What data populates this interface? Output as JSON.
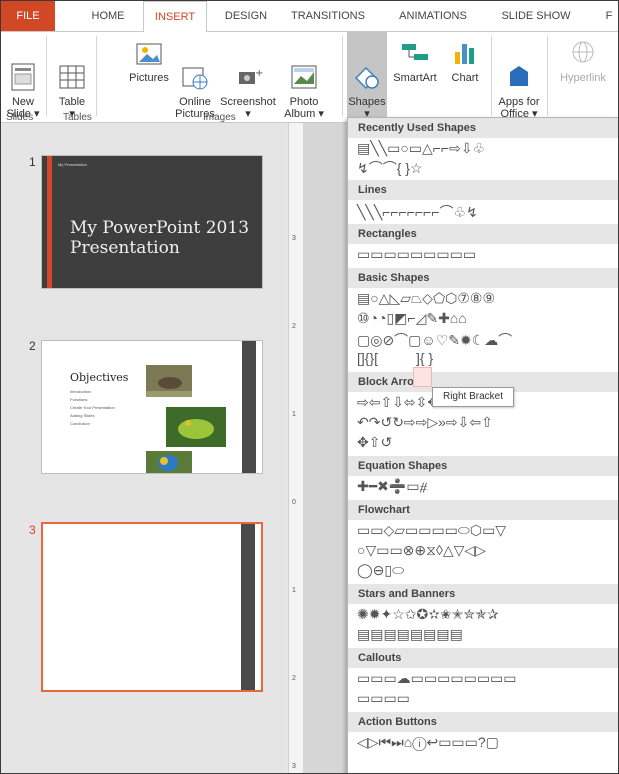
{
  "tabs": [
    {
      "label": "FILE"
    },
    {
      "label": "HOME"
    },
    {
      "label": "INSERT"
    },
    {
      "label": "DESIGN"
    },
    {
      "label": "TRANSITIONS"
    },
    {
      "label": "ANIMATIONS"
    },
    {
      "label": "SLIDE SHOW"
    },
    {
      "label": "F"
    }
  ],
  "ribbon": {
    "new_slide": "New\nSlide ▾",
    "table": "Table\n▾",
    "pictures": "Pictures",
    "online_pictures": "Online\nPictures",
    "screenshot": "Screenshot\n▾",
    "photo_album": "Photo\nAlbum ▾",
    "shapes": "Shapes\n▾",
    "smartart": "SmartArt",
    "chart": "Chart",
    "apps_for_office": "Apps for\nOffice ▾",
    "hyperlink": "Hyperlink",
    "group_slides": "Slides",
    "group_tables": "Tables",
    "group_images": "Images"
  },
  "slides": {
    "n1": "1",
    "n2": "2",
    "n3": "3",
    "s1_tiny": "My Presentation",
    "s1_title": "My PowerPoint 2013 Presentation",
    "s2_title": "Objectives",
    "s2_bullets": [
      "Introduction",
      "Functions",
      "Create Your Presentation",
      "Adding Slides",
      "Conclusion"
    ]
  },
  "ruler": {
    "n1": "3",
    "n2": "2",
    "n3": "1",
    "n4": "0",
    "n5": "1",
    "n6": "2",
    "n7": "3"
  },
  "gallery": {
    "recently_used": "Recently Used Shapes",
    "recent_row1": "▤╲╲▭○▭△⌐⌐⇨⇩♧",
    "recent_row2": "↯⌒⌒{ }☆",
    "lines": "Lines",
    "lines_row": "╲╲╲⌐⌐⌐⌐⌐⌐⌐⌒♧↯",
    "rectangles": "Rectangles",
    "rect_row": "▭▭▭▭▭▭▭▭▭",
    "basic": "Basic Shapes",
    "basic_row1": "▤○△◺▱⏢◇⬠⬡⑦⑧⑨",
    "basic_row2": "⑩◔◔▯◩⌐◿✎✚⌂⌂",
    "basic_row3": "▢◎⊘⌒▢☺♡✎✹☾☁⌒",
    "basic_row4": "[]{}[",
    "basic_row4b": "]{ }",
    "block": "Block Arrows",
    "block_row1": "⇨⇦⇧⇩⬄⇳✥⇫↱↱↰⇫",
    "block_row2": "↶↷↺↻⇨⇨▷»⇨⇩⇦⇧",
    "block_row3": "✥⇧↺",
    "equation": "Equation Shapes",
    "equation_row": "✚━✖➗▭⧣",
    "flowchart": "Flowchart",
    "flow_row1": "▭▭◇▱▭▭▭▭⬭⬡▭▽",
    "flow_row2": "○▽▭▭⊗⊕⧖◊△▽◁▷",
    "flow_row3": "◯⊖▯⬭",
    "stars": "Stars and Banners",
    "stars_row1": "✺✹✦☆✩✪✫✬✭✮✯✰",
    "stars_row2": "▤▤▤▤▤▤▤▤",
    "callouts": "Callouts",
    "callouts_row1": "▭▭▭☁▭▭▭▭▭▭▭▭",
    "callouts_row2": "▭▭▭▭",
    "action": "Action Buttons",
    "action_row": "◁▷⏮⏭⌂ⓘ↩▭▭▭?▢"
  },
  "tooltip": "Right Bracket"
}
